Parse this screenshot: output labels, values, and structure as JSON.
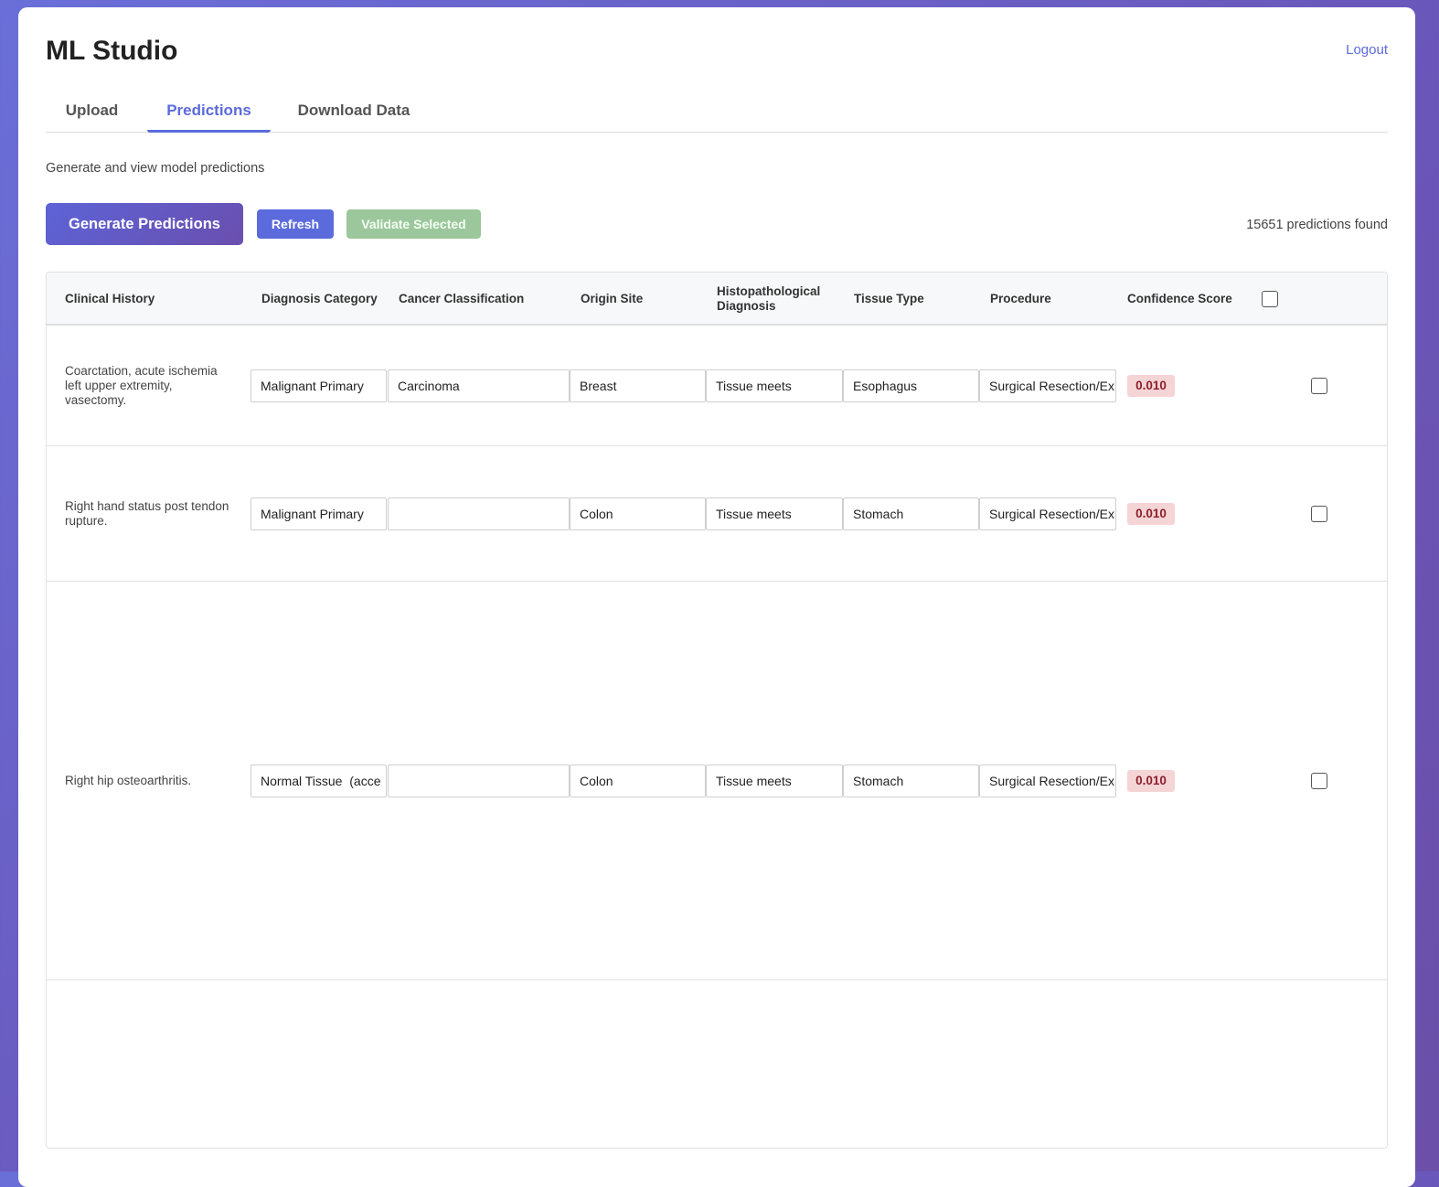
{
  "header": {
    "title": "ML Studio",
    "logout_label": "Logout"
  },
  "tabs": [
    {
      "label": "Upload",
      "active": false
    },
    {
      "label": "Predictions",
      "active": true
    },
    {
      "label": "Download Data",
      "active": false
    }
  ],
  "subtitle": "Generate and view model predictions",
  "toolbar": {
    "generate_label": "Generate Predictions",
    "refresh_label": "Refresh",
    "validate_label": "Validate Selected",
    "count_text": "15651 predictions found"
  },
  "table": {
    "columns": {
      "clinical_history": "Clinical History",
      "diagnosis_category": "Diagnosis Category",
      "cancer_classification": "Cancer Classification",
      "origin_site": "Origin Site",
      "histo_line1": "Histopathological",
      "histo_line2": "Diagnosis",
      "tissue_type": "Tissue Type",
      "procedure": "Procedure",
      "confidence_score": "Confidence Score"
    },
    "rows": [
      {
        "history_lines": [
          "Coarctation, acute ischemia",
          "left upper extremity,",
          "vasectomy."
        ],
        "diagnosis_category": "Malignant Primary",
        "cancer_classification": "Carcinoma",
        "origin_site": "Breast",
        "histo_diagnosis": "Tissue meets criteria",
        "tissue_type": "Esophagus",
        "procedure": "Surgical Resection/Ex",
        "confidence": "0.010"
      },
      {
        "history_lines": [
          "Right hand status post tendon",
          "rupture."
        ],
        "diagnosis_category": "Malignant Primary",
        "cancer_classification": "",
        "origin_site": "Colon",
        "histo_diagnosis": "Tissue meets criteria",
        "tissue_type": "Stomach",
        "procedure": "Surgical Resection/Ex",
        "confidence": "0.010"
      },
      {
        "history_lines": [
          "Right hip osteoarthritis."
        ],
        "diagnosis_category": "Normal Tissue  (acce",
        "cancer_classification": "",
        "origin_site": "Colon",
        "histo_diagnosis": "Tissue meets criteria",
        "tissue_type": "Stomach",
        "procedure": "Surgical Resection/Ex",
        "confidence": "0.010"
      }
    ]
  },
  "colors": {
    "accent": "#5b6bdc",
    "success_muted": "#9cc79c",
    "score_bg": "#f5d4d6",
    "score_text": "#8b1f2b"
  }
}
